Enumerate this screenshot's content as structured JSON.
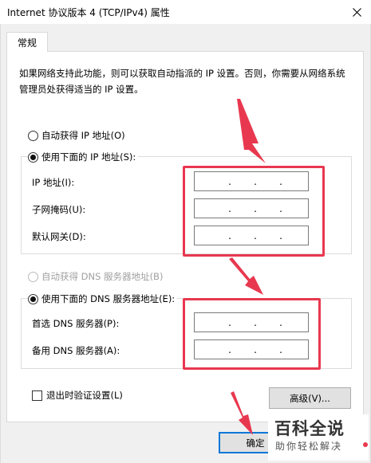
{
  "window": {
    "title": "Internet 协议版本 4 (TCP/IPv4) 属性",
    "close_glyph": "✕"
  },
  "tabs": [
    {
      "label": "常规",
      "active": true
    }
  ],
  "description": "如果网络支持此功能，则可以获取自动指派的 IP 设置。否则，你需要从网络系统管理员处获得适当的 IP 设置。",
  "ip_section": {
    "auto_radio": {
      "label": "自动获得 IP 地址(O)",
      "checked": false
    },
    "manual_radio": {
      "label": "使用下面的 IP 地址(S):",
      "checked": true
    },
    "fields": [
      {
        "label": "IP 地址(I):",
        "value": ".  .  ."
      },
      {
        "label": "子网掩码(U):",
        "value": ".  .  ."
      },
      {
        "label": "默认网关(D):",
        "value": ".  .  ."
      }
    ]
  },
  "dns_section": {
    "auto_radio": {
      "label": "自动获得 DNS 服务器地址(B)",
      "checked": false,
      "disabled": true
    },
    "manual_radio": {
      "label": "使用下面的 DNS 服务器地址(E):",
      "checked": true
    },
    "fields": [
      {
        "label": "首选 DNS 服务器(P):",
        "value": ".  .  ."
      },
      {
        "label": "备用 DNS 服务器(A):",
        "value": ".  .  ."
      }
    ]
  },
  "validate_checkbox": {
    "label": "退出时验证设置(L)",
    "checked": false
  },
  "buttons": {
    "advanced": "高级(V)...",
    "ok": "确定"
  },
  "watermark": {
    "title": "百科全说",
    "subtitle": "助你轻松解决"
  },
  "colors": {
    "annotation": "#e8384f",
    "client_bg": "#f0f0f0"
  }
}
